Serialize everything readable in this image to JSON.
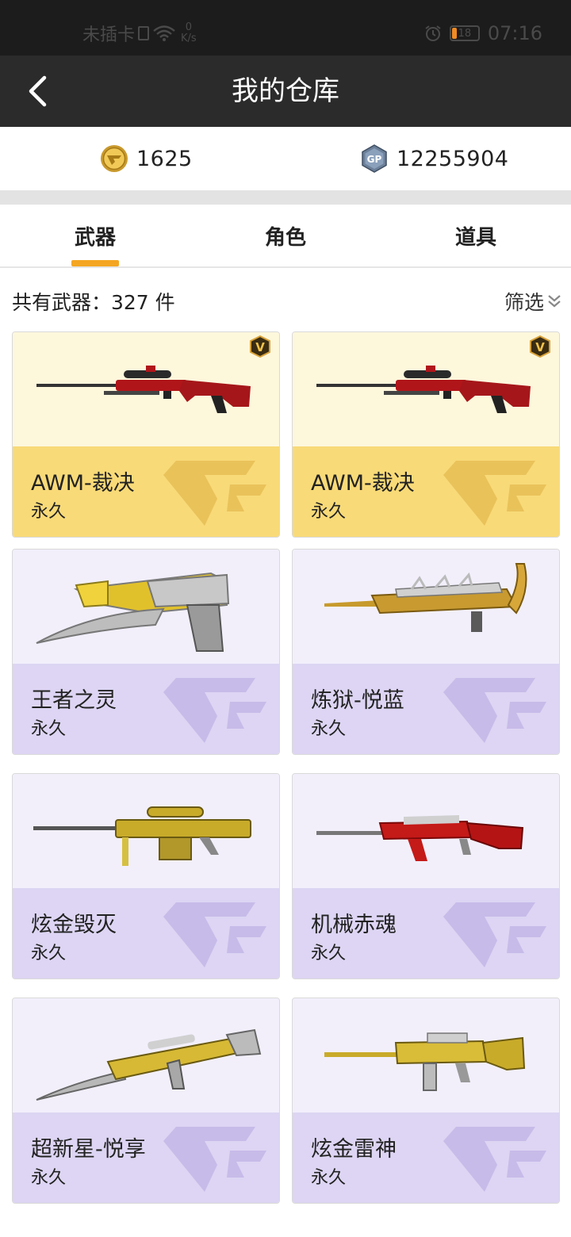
{
  "status_bar": {
    "carrier": "未插卡",
    "net_speed_value": "0",
    "net_speed_unit": "K/s",
    "battery_level": "18",
    "time": "07:16"
  },
  "nav": {
    "title": "我的仓库"
  },
  "currency": {
    "cf_points": "1625",
    "gp_label": "GP",
    "gp_points": "12255904"
  },
  "tabs": [
    {
      "label": "武器",
      "active": true
    },
    {
      "label": "角色",
      "active": false
    },
    {
      "label": "道具",
      "active": false
    }
  ],
  "list_header": {
    "count_text": "共有武器：327 件",
    "filter_label": "筛选"
  },
  "vip_label": "V",
  "weapons": [
    {
      "name": "AWM-裁决",
      "duration": "永久",
      "vip": true,
      "theme": "gold",
      "icon": "sniper-rifle-red-icon"
    },
    {
      "name": "AWM-裁决",
      "duration": "永久",
      "vip": true,
      "theme": "gold",
      "icon": "sniper-rifle-red-icon"
    },
    {
      "name": "王者之灵",
      "duration": "永久",
      "vip": false,
      "theme": "purple",
      "icon": "pistol-blade-gold-icon"
    },
    {
      "name": "炼狱-悦蓝",
      "duration": "永久",
      "vip": false,
      "theme": "purple",
      "icon": "dragon-rifle-gold-icon"
    },
    {
      "name": "炫金毁灭",
      "duration": "永久",
      "vip": false,
      "theme": "purple",
      "icon": "heavy-sniper-gold-icon"
    },
    {
      "name": "机械赤魂",
      "duration": "永久",
      "vip": false,
      "theme": "purple",
      "icon": "assault-rifle-red-icon"
    },
    {
      "name": "超新星-悦享",
      "duration": "永久",
      "vip": false,
      "theme": "purple",
      "icon": "assault-rifle-gold-blade-icon"
    },
    {
      "name": "炫金雷神",
      "duration": "永久",
      "vip": false,
      "theme": "purple",
      "icon": "carbine-gold-icon"
    }
  ],
  "colors": {
    "gold_card_top": "#fdf7dc",
    "gold_card_bottom": "#f8da78",
    "purple_card_top": "#f2effb",
    "purple_card_bottom": "#ddd5f3",
    "tab_accent": "#f4a622",
    "nav_bg": "#2b2b2b"
  }
}
